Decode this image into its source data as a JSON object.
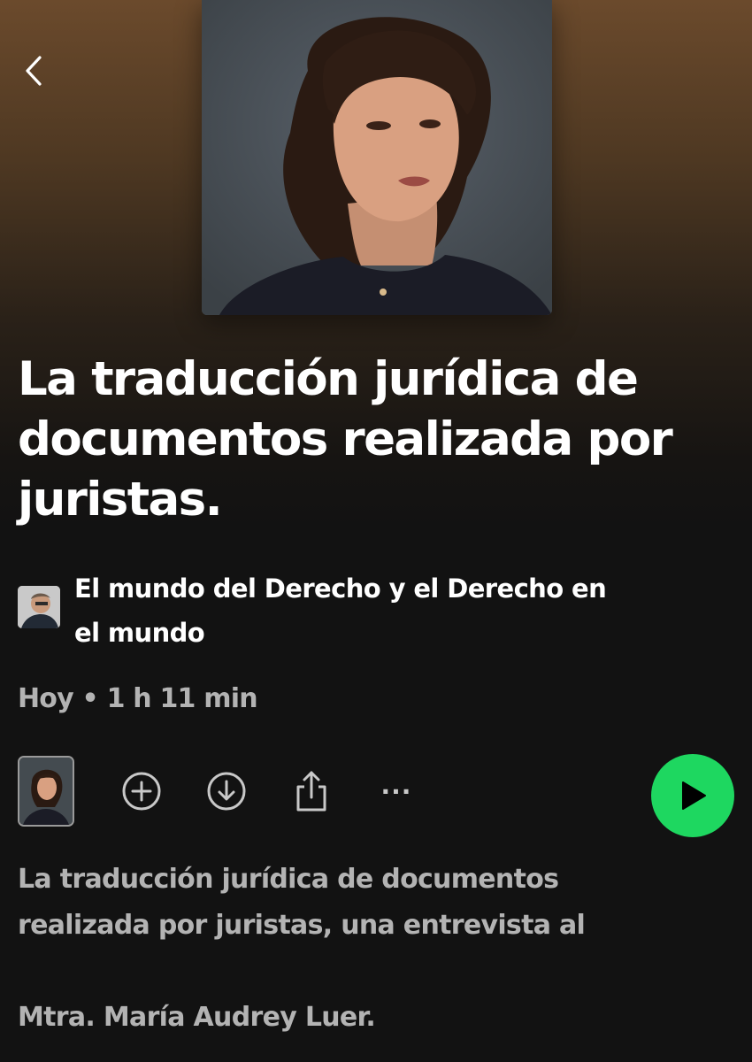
{
  "nav": {
    "back_icon": "chevron-left-icon"
  },
  "episode": {
    "title_lines": [
      "La traducción jurídica de",
      "documentos realizada por",
      "juristas."
    ],
    "show_name_lines": [
      "El mundo del Derecho y el Derecho en",
      "el mundo"
    ],
    "date": "Hoy",
    "separator": "•",
    "duration": "1 h 11 min",
    "description_lines": [
      "La traducción jurídica de documentos",
      "realizada por juristas, una entrevista al"
    ],
    "description_tail": "Mtra. María Audrey Luer."
  },
  "actions": {
    "add_icon": "plus-circle-icon",
    "download_icon": "download-circle-icon",
    "share_icon": "share-icon",
    "more_label": "···",
    "play_icon": "play-icon"
  },
  "colors": {
    "accent": "#1ed760",
    "background": "#121212",
    "header_gradient_top": "#6b4a2c",
    "secondary_text": "#b3b3b3"
  }
}
